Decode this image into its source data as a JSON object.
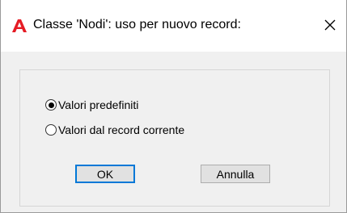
{
  "window": {
    "title": "Classe 'Nodi': uso per nuovo record:",
    "icon": "autocad-a-icon",
    "brand_color": "#e51b24"
  },
  "options": {
    "default_values": {
      "label": "Valori predefiniti",
      "checked": true
    },
    "current_record_values": {
      "label": "Valori dal record corrente",
      "checked": false
    }
  },
  "buttons": {
    "ok_label": "OK",
    "cancel_label": "Annulla"
  },
  "colors": {
    "default_button_border": "#0078d7"
  }
}
